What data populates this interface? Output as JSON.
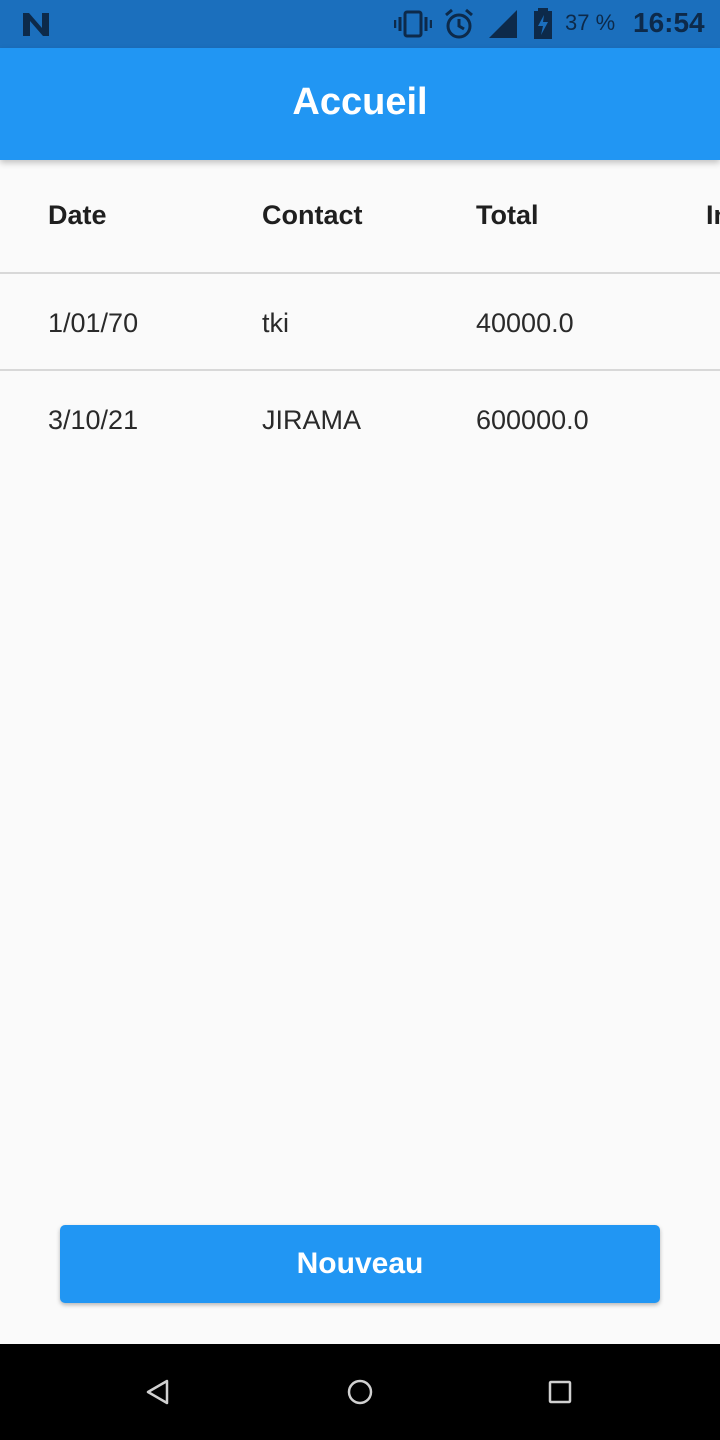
{
  "status_bar": {
    "battery_percent": "37 %",
    "time": "16:54",
    "icons": [
      "notification-n-icon",
      "vibrate-icon",
      "alarm-icon",
      "signal-icon",
      "battery-charging-icon"
    ]
  },
  "app_bar": {
    "title": "Accueil"
  },
  "table": {
    "columns": [
      "Date",
      "Contact",
      "Total",
      "In"
    ],
    "rows": [
      {
        "date": "1/01/70",
        "contact": "tki",
        "total": "40000.0"
      },
      {
        "date": "3/10/21",
        "contact": "JIRAMA",
        "total": "600000.0"
      }
    ]
  },
  "actions": {
    "new_label": "Nouveau"
  },
  "nav_bar": {
    "icons": [
      "back-icon",
      "home-icon",
      "recents-icon"
    ]
  },
  "colors": {
    "primary": "#2196f3",
    "status_bar": "#1b6fbd",
    "background": "#fafafa",
    "divider": "#d8d8d8"
  }
}
